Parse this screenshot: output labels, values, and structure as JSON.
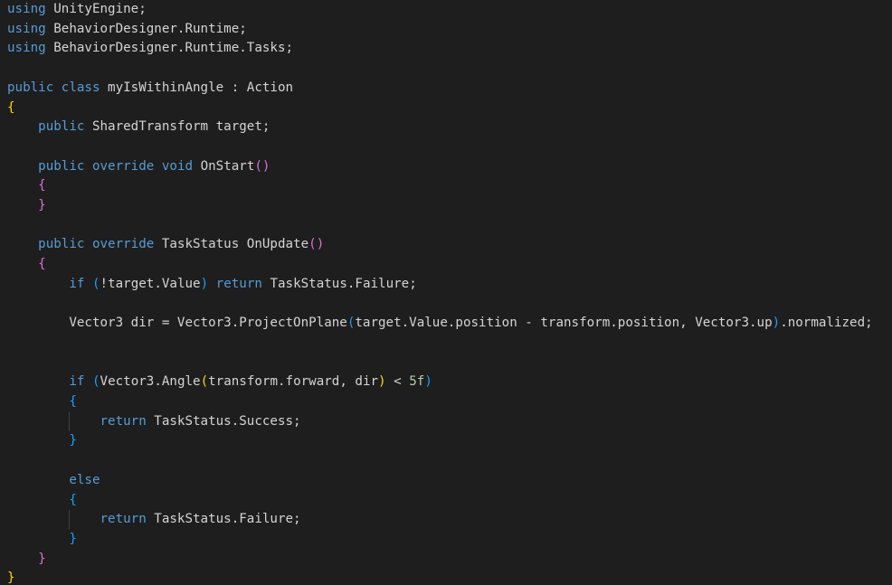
{
  "editor": {
    "language": "csharp",
    "theme": {
      "background": "#1e1e1e",
      "default": "#d4d4d4",
      "keyword": "#569cd6",
      "control": "#c586c0",
      "brace_gold": "#ffd700",
      "brace_pink": "#da70d6",
      "brace_blue": "#179fff",
      "number": "#b5cea8"
    },
    "lines": [
      {
        "row": 0,
        "tokens": [
          {
            "text": "using",
            "c": "#569cd6"
          },
          {
            "text": " UnityEngine;",
            "c": "#d4d4d4"
          }
        ]
      },
      {
        "row": 1,
        "tokens": [
          {
            "text": "using",
            "c": "#569cd6"
          },
          {
            "text": " BehaviorDesigner.Runtime;",
            "c": "#d4d4d4"
          }
        ]
      },
      {
        "row": 2,
        "tokens": [
          {
            "text": "using",
            "c": "#569cd6"
          },
          {
            "text": " BehaviorDesigner.Runtime.Tasks;",
            "c": "#d4d4d4"
          }
        ]
      },
      {
        "row": 4,
        "tokens": [
          {
            "text": "public",
            "c": "#569cd6"
          },
          {
            "text": " ",
            "c": "#d4d4d4"
          },
          {
            "text": "class",
            "c": "#569cd6"
          },
          {
            "text": " myIsWithinAngle : Action",
            "c": "#d4d4d4"
          }
        ]
      },
      {
        "row": 5,
        "tokens": [
          {
            "text": "{",
            "c": "#ffd700"
          }
        ]
      },
      {
        "row": 6,
        "tokens": [
          {
            "text": "    ",
            "c": "#d4d4d4"
          },
          {
            "text": "public",
            "c": "#569cd6"
          },
          {
            "text": " SharedTransform target;",
            "c": "#d4d4d4"
          }
        ]
      },
      {
        "row": 8,
        "tokens": [
          {
            "text": "    ",
            "c": "#d4d4d4"
          },
          {
            "text": "public",
            "c": "#569cd6"
          },
          {
            "text": " ",
            "c": "#d4d4d4"
          },
          {
            "text": "override",
            "c": "#569cd6"
          },
          {
            "text": " ",
            "c": "#d4d4d4"
          },
          {
            "text": "void",
            "c": "#569cd6"
          },
          {
            "text": " OnStart",
            "c": "#d4d4d4"
          },
          {
            "text": "()",
            "c": "#da70d6"
          }
        ]
      },
      {
        "row": 9,
        "tokens": [
          {
            "text": "    ",
            "c": "#d4d4d4"
          },
          {
            "text": "{",
            "c": "#da70d6"
          }
        ]
      },
      {
        "row": 10,
        "tokens": [
          {
            "text": "    ",
            "c": "#d4d4d4"
          },
          {
            "text": "}",
            "c": "#da70d6"
          }
        ]
      },
      {
        "row": 12,
        "tokens": [
          {
            "text": "    ",
            "c": "#d4d4d4"
          },
          {
            "text": "public",
            "c": "#569cd6"
          },
          {
            "text": " ",
            "c": "#d4d4d4"
          },
          {
            "text": "override",
            "c": "#569cd6"
          },
          {
            "text": " TaskStatus OnUpdate",
            "c": "#d4d4d4"
          },
          {
            "text": "()",
            "c": "#da70d6"
          }
        ]
      },
      {
        "row": 13,
        "tokens": [
          {
            "text": "    ",
            "c": "#d4d4d4"
          },
          {
            "text": "{",
            "c": "#da70d6"
          }
        ]
      },
      {
        "row": 14,
        "tokens": [
          {
            "text": "        ",
            "c": "#d4d4d4"
          },
          {
            "text": "if",
            "c": "#569cd6"
          },
          {
            "text": " ",
            "c": "#d4d4d4"
          },
          {
            "text": "(",
            "c": "#179fff"
          },
          {
            "text": "!target.Value",
            "c": "#d4d4d4"
          },
          {
            "text": ")",
            "c": "#179fff"
          },
          {
            "text": " ",
            "c": "#d4d4d4"
          },
          {
            "text": "return",
            "c": "#569cd6"
          },
          {
            "text": " TaskStatus.Failure;",
            "c": "#d4d4d4"
          }
        ]
      },
      {
        "row": 16,
        "tokens": [
          {
            "text": "        Vector3 dir = Vector3.ProjectOnPlane",
            "c": "#d4d4d4"
          },
          {
            "text": "(",
            "c": "#179fff"
          },
          {
            "text": "target.Value.position - transform.position, Vector3.up",
            "c": "#d4d4d4"
          },
          {
            "text": ")",
            "c": "#179fff"
          },
          {
            "text": ".normalized;",
            "c": "#d4d4d4"
          }
        ]
      },
      {
        "row": 19,
        "tokens": [
          {
            "text": "        ",
            "c": "#d4d4d4"
          },
          {
            "text": "if",
            "c": "#569cd6"
          },
          {
            "text": " ",
            "c": "#d4d4d4"
          },
          {
            "text": "(",
            "c": "#179fff"
          },
          {
            "text": "Vector3.Angle",
            "c": "#d4d4d4"
          },
          {
            "text": "(",
            "c": "#ffd700"
          },
          {
            "text": "transform.forward, dir",
            "c": "#d4d4d4"
          },
          {
            "text": ")",
            "c": "#ffd700"
          },
          {
            "text": " < ",
            "c": "#d4d4d4"
          },
          {
            "text": "5f",
            "c": "#b5cea8"
          },
          {
            "text": ")",
            "c": "#179fff"
          }
        ]
      },
      {
        "row": 20,
        "tokens": [
          {
            "text": "        ",
            "c": "#d4d4d4"
          },
          {
            "text": "{",
            "c": "#179fff"
          }
        ]
      },
      {
        "row": 21,
        "tokens": [
          {
            "text": "            ",
            "c": "#d4d4d4"
          },
          {
            "text": "return",
            "c": "#569cd6"
          },
          {
            "text": " TaskStatus.Success;",
            "c": "#d4d4d4"
          }
        ]
      },
      {
        "row": 22,
        "tokens": [
          {
            "text": "        ",
            "c": "#d4d4d4"
          },
          {
            "text": "}",
            "c": "#179fff"
          }
        ]
      },
      {
        "row": 24,
        "tokens": [
          {
            "text": "        ",
            "c": "#d4d4d4"
          },
          {
            "text": "else",
            "c": "#569cd6"
          }
        ]
      },
      {
        "row": 25,
        "tokens": [
          {
            "text": "        ",
            "c": "#d4d4d4"
          },
          {
            "text": "{",
            "c": "#179fff"
          }
        ]
      },
      {
        "row": 26,
        "tokens": [
          {
            "text": "            ",
            "c": "#d4d4d4"
          },
          {
            "text": "return",
            "c": "#569cd6"
          },
          {
            "text": " TaskStatus.Failure;",
            "c": "#d4d4d4"
          }
        ]
      },
      {
        "row": 27,
        "tokens": [
          {
            "text": "        ",
            "c": "#d4d4d4"
          },
          {
            "text": "}",
            "c": "#179fff"
          }
        ]
      },
      {
        "row": 28,
        "tokens": [
          {
            "text": "    ",
            "c": "#d4d4d4"
          },
          {
            "text": "}",
            "c": "#da70d6"
          }
        ]
      },
      {
        "row": 29,
        "tokens": [
          {
            "text": "}",
            "c": "#ffd700"
          }
        ]
      }
    ]
  }
}
